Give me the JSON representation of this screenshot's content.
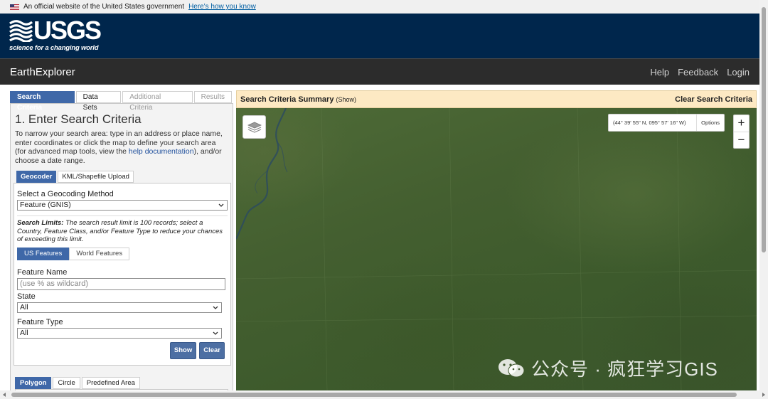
{
  "gov_banner": {
    "text": "An official website of the United States government",
    "link": "Here's how you know",
    "flag_icon": "us-flag-icon"
  },
  "usgs": {
    "logo_text": "USGS",
    "tagline": "science for a changing world"
  },
  "nav": {
    "title": "EarthExplorer",
    "links": [
      "Help",
      "Feedback",
      "Login"
    ]
  },
  "left_panel": {
    "tabs": [
      "Search Criteria",
      "Data Sets",
      "Additional Criteria",
      "Results"
    ],
    "active_tab": "Search Criteria",
    "heading": "1. Enter Search Criteria",
    "intro_before": "To narrow your search area: type in an address or place name, enter coordinates or click the map to define your search area (for advanced map tools, view the ",
    "intro_link": "help documentation",
    "intro_after": "), and/or choose a date range.",
    "sub_tabs": [
      "Geocoder",
      "KML/Shapefile Upload"
    ],
    "geocoder": {
      "method_label": "Select a Geocoding Method",
      "method_value": "Feature (GNIS)",
      "limits_bold": "Search Limits:",
      "limits_text": " The search result limit is 100 records; select a Country, Feature Class, and/or Feature Type to reduce your chances of exceeding this limit.",
      "feature_tabs": [
        "US Features",
        "World Features"
      ],
      "feature_name_label": "Feature Name",
      "feature_name_placeholder": "(use % as wildcard)",
      "state_label": "State",
      "state_value": "All",
      "feature_type_label": "Feature Type",
      "feature_type_value": "All",
      "show_button": "Show",
      "clear_button": "Clear"
    },
    "area_tabs": [
      "Polygon",
      "Circle",
      "Predefined Area"
    ]
  },
  "map": {
    "summary_title": "Search Criteria Summary",
    "summary_show": "(Show)",
    "clear_all": "Clear Search Criteria",
    "coordinates": "(44° 39' 55\" N, 095° 57' 16\" W)",
    "options": "Options",
    "zoom_in": "+",
    "zoom_out": "−",
    "layers_icon": "layers-icon",
    "watermark": "公众号 · 疯狂学习GIS"
  },
  "colors": {
    "usgs_navy": "#00264c",
    "nav_dark": "#2c2c2c",
    "accent_blue": "#3f68a8",
    "summary_bg": "#fde9c3",
    "map_green": "#445f30"
  }
}
